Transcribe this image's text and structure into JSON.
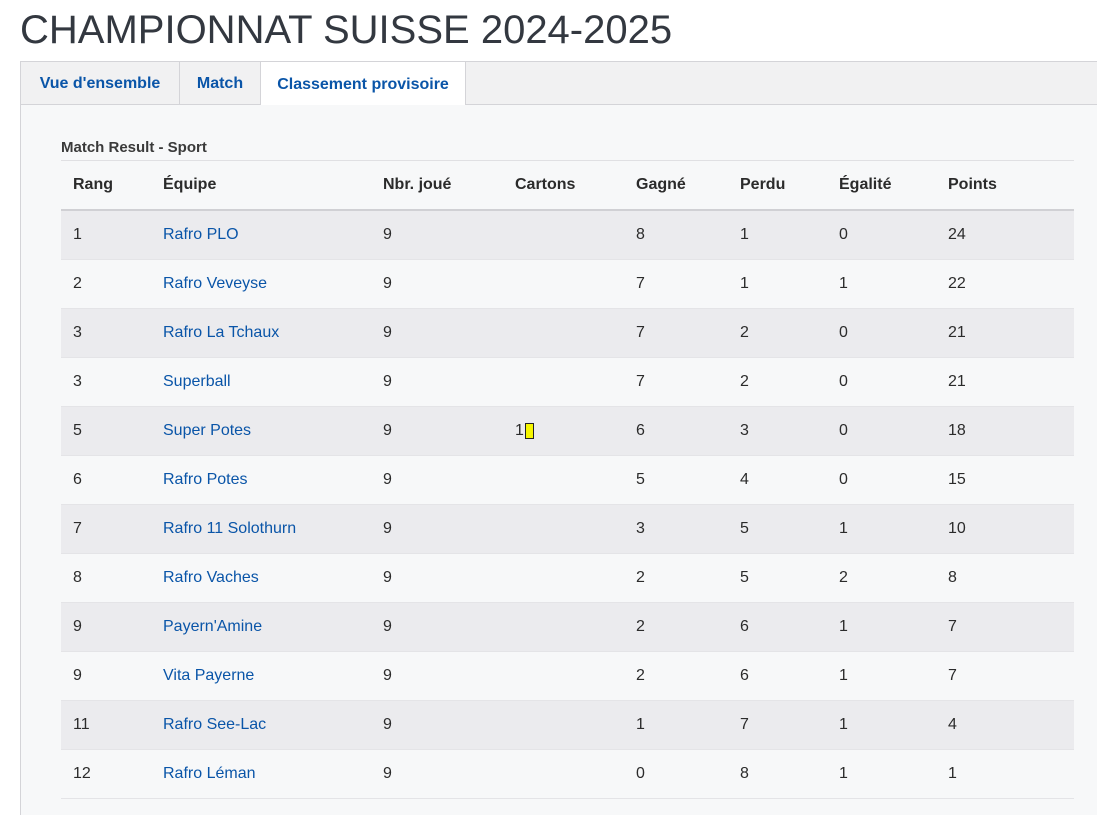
{
  "page": {
    "title": "CHAMPIONNAT SUISSE 2024-2025"
  },
  "tabs": [
    {
      "label": "Vue d'ensemble",
      "active": false
    },
    {
      "label": "Match",
      "active": false
    },
    {
      "label": "Classement provisoire",
      "active": true
    }
  ],
  "standings": {
    "caption": "Match Result - Sport",
    "columns": [
      "Rang",
      "Équipe",
      "Nbr. joué",
      "Cartons",
      "Gagné",
      "Perdu",
      "Égalité",
      "Points"
    ],
    "rows": [
      {
        "rank": "1",
        "team": "Rafro PLO",
        "played": "9",
        "cards": "",
        "won": "8",
        "lost": "1",
        "draw": "0",
        "points": "24"
      },
      {
        "rank": "2",
        "team": "Rafro Veveyse",
        "played": "9",
        "cards": "",
        "won": "7",
        "lost": "1",
        "draw": "1",
        "points": "22"
      },
      {
        "rank": "3",
        "team": "Rafro La Tchaux",
        "played": "9",
        "cards": "",
        "won": "7",
        "lost": "2",
        "draw": "0",
        "points": "21"
      },
      {
        "rank": "3",
        "team": "Superball",
        "played": "9",
        "cards": "",
        "won": "7",
        "lost": "2",
        "draw": "0",
        "points": "21"
      },
      {
        "rank": "5",
        "team": "Super Potes",
        "played": "9",
        "cards": "1",
        "won": "6",
        "lost": "3",
        "draw": "0",
        "points": "18"
      },
      {
        "rank": "6",
        "team": "Rafro Potes",
        "played": "9",
        "cards": "",
        "won": "5",
        "lost": "4",
        "draw": "0",
        "points": "15"
      },
      {
        "rank": "7",
        "team": "Rafro 11 Solothurn",
        "played": "9",
        "cards": "",
        "won": "3",
        "lost": "5",
        "draw": "1",
        "points": "10"
      },
      {
        "rank": "8",
        "team": "Rafro Vaches",
        "played": "9",
        "cards": "",
        "won": "2",
        "lost": "5",
        "draw": "2",
        "points": "8"
      },
      {
        "rank": "9",
        "team": "Payern'Amine",
        "played": "9",
        "cards": "",
        "won": "2",
        "lost": "6",
        "draw": "1",
        "points": "7"
      },
      {
        "rank": "9",
        "team": "Vita Payerne",
        "played": "9",
        "cards": "",
        "won": "2",
        "lost": "6",
        "draw": "1",
        "points": "7"
      },
      {
        "rank": "11",
        "team": "Rafro See-Lac",
        "played": "9",
        "cards": "",
        "won": "1",
        "lost": "7",
        "draw": "1",
        "points": "4"
      },
      {
        "rank": "12",
        "team": "Rafro Léman",
        "played": "9",
        "cards": "",
        "won": "0",
        "lost": "8",
        "draw": "1",
        "points": "1"
      }
    ]
  },
  "colors": {
    "link": "#0a55a8",
    "yellow_card": "#f6f600",
    "row_stripe": "#ebebee",
    "panel_bg": "#f7f8f9"
  },
  "icons": {
    "card": "yellow-card-icon"
  }
}
